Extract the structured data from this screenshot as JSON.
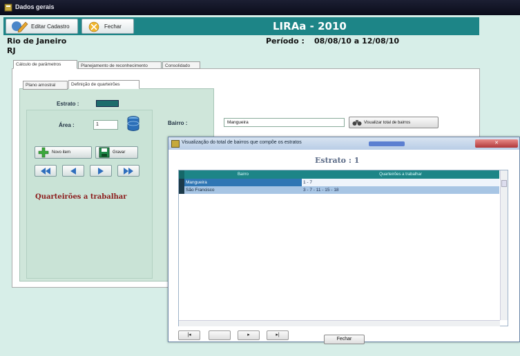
{
  "window": {
    "title": "Dados gerais"
  },
  "toolbar": {
    "editar_label": "Editar Cadastro",
    "fechar_label": "Fechar",
    "app_title": "LIRAa - 2010"
  },
  "header": {
    "city": "Rio de Janeiro",
    "state": "RJ",
    "period_label": "Período :",
    "period_value": "08/08/10 a 12/08/10"
  },
  "main_tabs": [
    {
      "label": "Cálculo de parâmetros",
      "active": true
    },
    {
      "label": "Planejamento de reconhecimento"
    },
    {
      "label": "Consolidado"
    }
  ],
  "sub_tabs": [
    {
      "label": "Plano amostral"
    },
    {
      "label": "Definição de quarteirões",
      "active": true
    }
  ],
  "form": {
    "estrato_label": "Estrato :",
    "area_label": "Área :",
    "area_value": "1",
    "bairro_label": "Bairro :",
    "bairro_value": "Mangueira",
    "visualizar_label": "Visualizar total de bairros",
    "novo_label": "Novo item",
    "gravar_label": "Gravar",
    "quarteiroes_label": "Quarteirões a trabalhar"
  },
  "dialog": {
    "title": "Visualização do total de bairros que compõe os estratos",
    "close_label": "✕",
    "estrato_title": "Estrato : 1",
    "columns": [
      "Bairro",
      "Quarteirões a trabalhar"
    ],
    "rows": [
      {
        "bairro": "Mangueira",
        "quarteiroes": "1 - 7"
      },
      {
        "bairro": "São Francisco",
        "quarteiroes": "3 - 7 - 11 - 15 - 18"
      }
    ],
    "nav": {
      "first": "|◂",
      "prev": "",
      "next": "▸",
      "last": "▸|"
    },
    "fechar_label": "Fechar"
  },
  "colors": {
    "accent": "#1d8587",
    "panel": "#d7eee8",
    "heading_red": "#8b1a1a"
  },
  "icons": [
    "window-icon",
    "pencil-icon",
    "close-icon",
    "database-icon",
    "binoculars-icon",
    "add-icon",
    "save-icon",
    "first-icon",
    "prev-icon",
    "next-icon",
    "last-icon"
  ]
}
